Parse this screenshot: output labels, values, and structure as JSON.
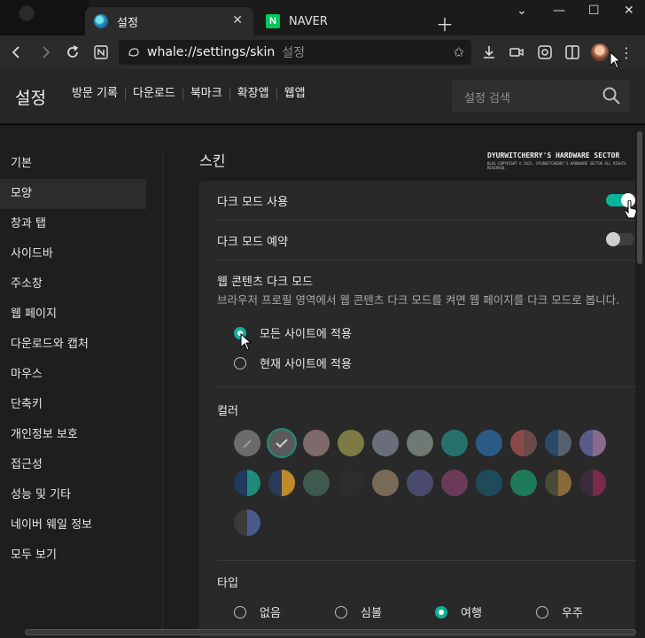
{
  "tabs": [
    {
      "title": "설정",
      "favicon": "whale-icon",
      "active": true
    },
    {
      "title": "NAVER",
      "favicon": "naver-icon",
      "favicon_text": "N",
      "active": false
    }
  ],
  "toolbar": {
    "url": "whale://settings/skin",
    "page_title": "설정"
  },
  "header": {
    "title": "설정",
    "nav": [
      "방문 기록",
      "다운로드",
      "북마크",
      "확장앱",
      "웹앱"
    ],
    "search_placeholder": "설정 검색"
  },
  "sidebar": {
    "items": [
      "기본",
      "모양",
      "창과 탭",
      "사이드바",
      "주소창",
      "웹 페이지",
      "다운로드와 캡처",
      "마우스",
      "단축키",
      "개인정보 보호",
      "접근성",
      "성능 및 기타",
      "네이버 웨일 정보",
      "모두 보기"
    ],
    "active_index": 1
  },
  "content": {
    "section_title": "스킨",
    "watermark_line1": "DYURWITCHERRY'S HARDWARE SECTOR",
    "watermark_line2": "BLOG COPYRIGHT © 2015. DYURWITCHERRY'S HARDWARE SECTOR ALL RIGHTS RESERVED.",
    "dark_mode_label": "다크 모드 사용",
    "dark_mode_on": true,
    "dark_mode_schedule_label": "다크 모드 예약",
    "dark_mode_schedule_on": false,
    "web_dark_title": "웹 콘텐츠 다크 모드",
    "web_dark_desc": "브라우저 프로필 영역에서 웹 콘텐츠 다크 모드를 켜면 웹 페이지를 다크 모드로 봅니다.",
    "web_dark_options": [
      "모든 사이트에 적용",
      "현재 사이트에 적용"
    ],
    "web_dark_selected": 0,
    "color_label": "컬러",
    "colors": [
      [
        "#6b6b6b"
      ],
      [
        "#5a5a5a"
      ],
      [
        "#7e6a6a"
      ],
      [
        "#7c7a45"
      ],
      [
        "#6a6e7a"
      ],
      [
        "#6f7872"
      ],
      [
        "#26726a"
      ],
      [
        "#2a5a86"
      ],
      [
        "#8a4a4a",
        "#6a4a4a"
      ],
      [
        "#2a4a6a",
        "#556070"
      ],
      [
        "#5a5a8a",
        "#8a6a8a"
      ],
      [
        "#1f3a5a",
        "#1f8a7a"
      ],
      [
        "#2a3a5a",
        "#c08a2a"
      ],
      [
        "#3d5a4c"
      ],
      [
        "#2c2c2c"
      ],
      [
        "#7a6a58"
      ],
      [
        "#4a4a6e"
      ],
      [
        "#6a3a58"
      ],
      [
        "#1f4a5a"
      ],
      [
        "#1f7a58"
      ],
      [
        "#4a4a3a",
        "#8a6a3a"
      ],
      [
        "#3a2a3a",
        "#7a2a4a"
      ],
      [
        "#3a3a3a",
        "#4a5a8a"
      ]
    ],
    "color_selected": 1,
    "type_label": "타입",
    "type_options": [
      "없음",
      "심볼",
      "여행",
      "우주"
    ],
    "type_selected": 2
  }
}
